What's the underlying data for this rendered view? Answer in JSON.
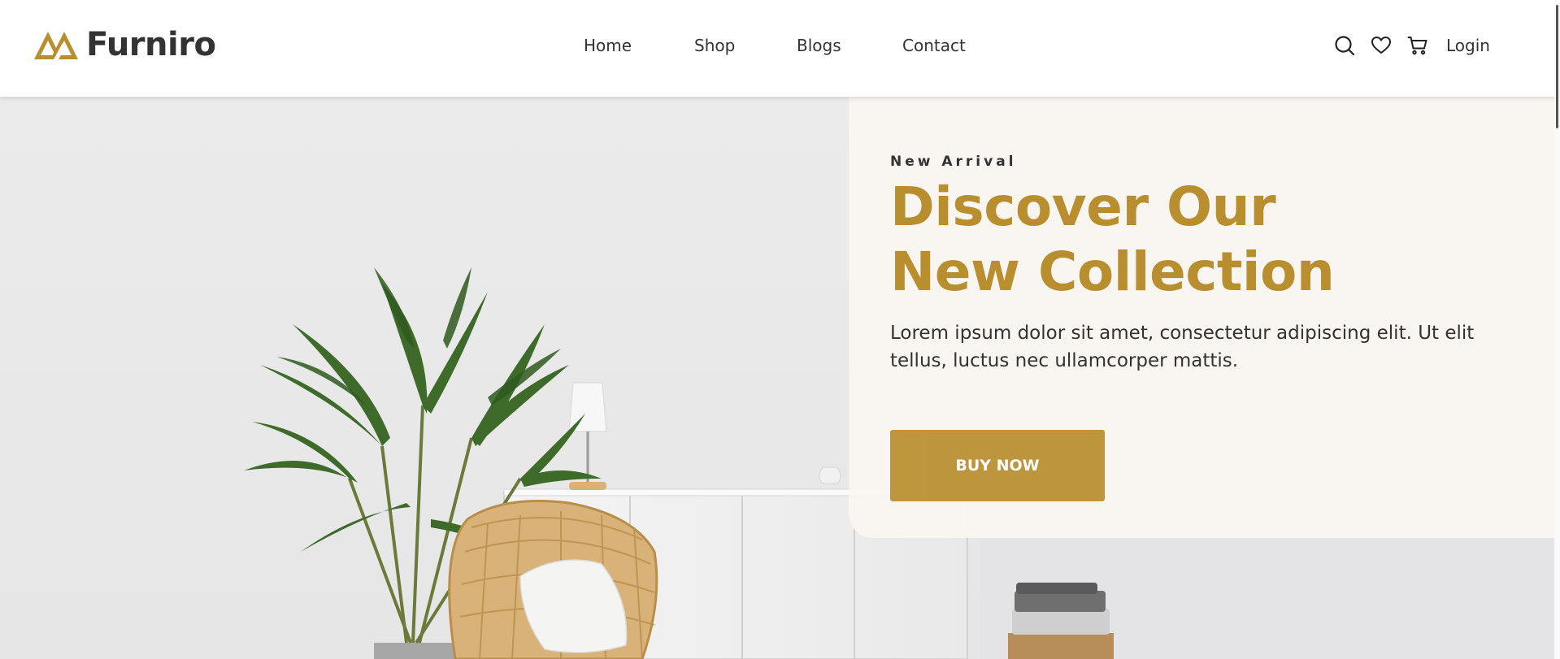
{
  "brand": {
    "name": "Furniro",
    "accent_color": "#B88E2F"
  },
  "nav": {
    "items": [
      {
        "label": "Home"
      },
      {
        "label": "Shop"
      },
      {
        "label": "Blogs"
      },
      {
        "label": "Contact"
      }
    ]
  },
  "header_actions": {
    "icons": [
      "search-icon",
      "heart-icon",
      "cart-icon"
    ],
    "login_label": "Login"
  },
  "hero": {
    "eyebrow": "New Arrival",
    "headline_line1": "Discover Our",
    "headline_line2": "New Collection",
    "description": "Lorem ipsum dolor sit amet, consectetur adipiscing elit. Ut elit tellus, luctus nec ullamcorper mattis.",
    "cta_label": "BUY NOW"
  }
}
